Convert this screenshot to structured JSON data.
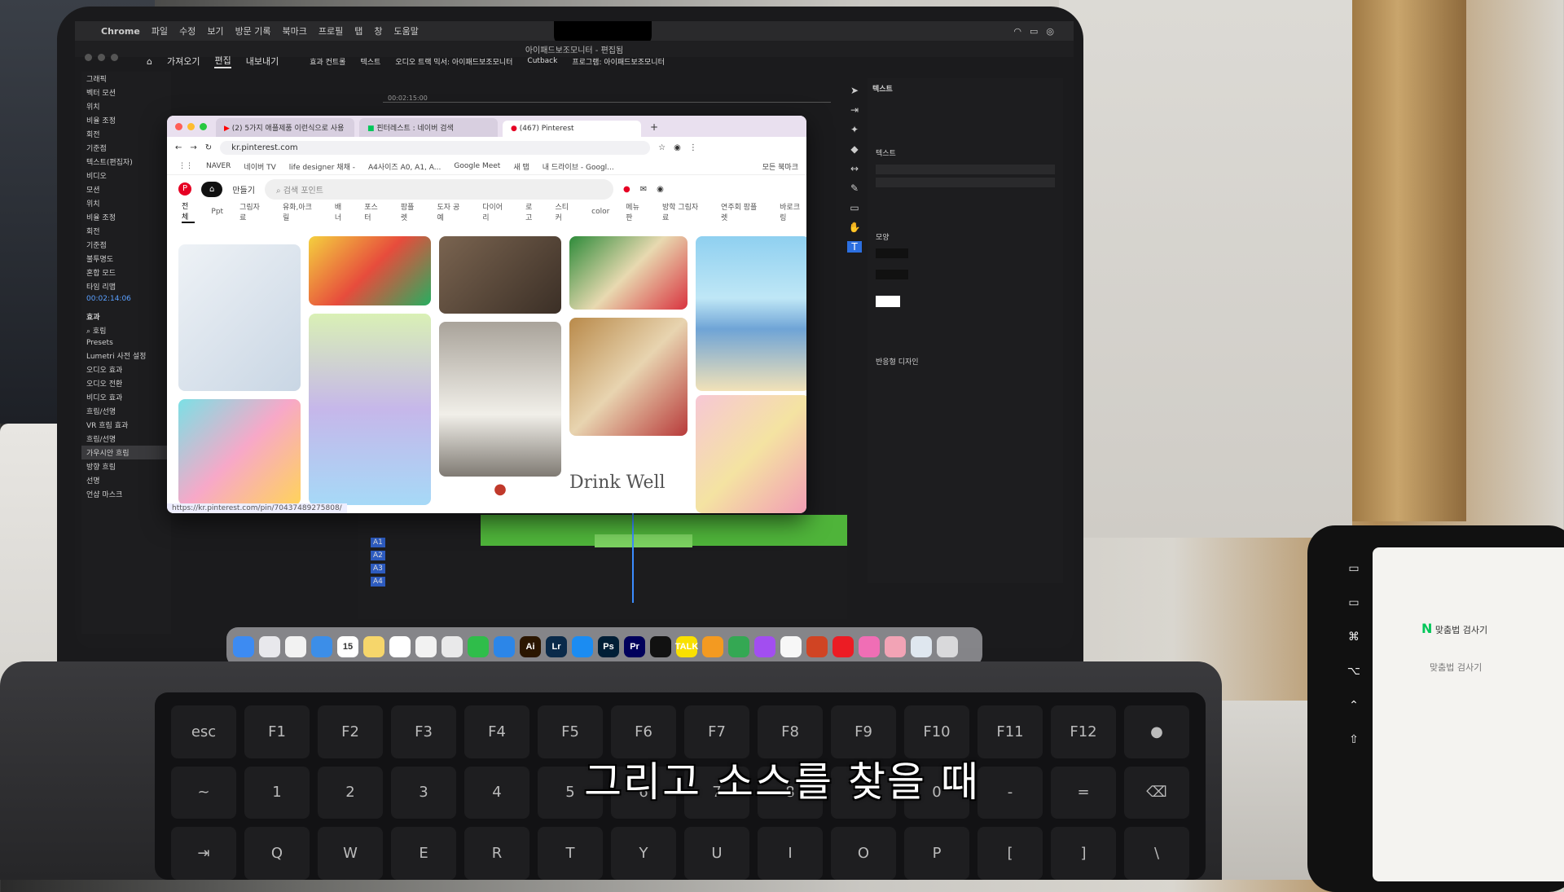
{
  "menubar": {
    "app": "Chrome",
    "items": [
      "파일",
      "수정",
      "보기",
      "방문 기록",
      "북마크",
      "프로필",
      "탭",
      "창",
      "도움말"
    ]
  },
  "premiere": {
    "title": "아이패드보조모니터 - 편집됨",
    "nav": [
      "가져오기",
      "편집",
      "내보내기"
    ],
    "panel_tabs": [
      "효과 컨트롤",
      "텍스트",
      "오디오 트랙 믹서: 아이패드보조모니터",
      "Cutback",
      "프로그램: 아이패드보조모니터"
    ],
    "left_items": [
      "그래픽",
      "벡터 모션",
      "위치",
      "비율 조정",
      "회전",
      "기준점",
      "텍스트(편집자)",
      "비디오",
      "모션",
      "위치",
      "비율 조정",
      "회전",
      "기준점",
      "불투명도",
      "혼합 모드",
      "타임 리맵"
    ],
    "timecode": "00:02:14:06",
    "ruler_time": "00:02:15:00",
    "effects_label": "효과",
    "effects_search": "호림",
    "effects_tree": [
      "Presets",
      "Lumetri 사전 설정",
      "오디오 효과",
      "오디오 전환",
      "비디오 효과",
      "흐림/선명",
      "VR 흐림 효과",
      "흐림/선명",
      "가우시안 흐림",
      "방향 흐림",
      "선명",
      "언샵 마스크"
    ],
    "tracks": [
      "A1",
      "A2",
      "A3",
      "A4"
    ],
    "right_title": "텍스트",
    "right_sections": [
      "텍스트",
      "모양",
      "반응형 디자인"
    ]
  },
  "chrome": {
    "tabs": [
      {
        "label": "(2) 5가지 애플제품 이런식으로 사용"
      },
      {
        "label": "핀터레스트 : 네이버 검색"
      },
      {
        "label": "(467) Pinterest"
      }
    ],
    "url": "kr.pinterest.com",
    "bookmarks": [
      "NAVER",
      "네이버 TV",
      "life designer 채채 -",
      "A4사이즈 A0, A1, A...",
      "Google Meet",
      "새 탭",
      "내 드라이브 - Googl...",
      "모든 북마크"
    ],
    "pinterest": {
      "create": "만들기",
      "search_placeholder": "검색 포인트",
      "categories": [
        "전체",
        "Ppt",
        "그림자료",
        "유화,아크릴",
        "배너",
        "포스터",
        "팜플렛",
        "도자 공예",
        "다이어리",
        "로고",
        "스티커",
        "color",
        "메뉴판",
        "방학 그림자료",
        "연주회 팜플렛",
        "바로크링"
      ],
      "pin_text": "Drink Well",
      "status_url": "https://kr.pinterest.com/pin/70437489275808/"
    }
  },
  "dock": {
    "icons": [
      {
        "name": "finder",
        "label": ""
      },
      {
        "name": "launchpad",
        "label": ""
      },
      {
        "name": "chrome",
        "label": ""
      },
      {
        "name": "safari",
        "label": ""
      },
      {
        "name": "calendar",
        "label": "15"
      },
      {
        "name": "notes",
        "label": ""
      },
      {
        "name": "reminders",
        "label": ""
      },
      {
        "name": "textedit",
        "label": ""
      },
      {
        "name": "mail",
        "label": ""
      },
      {
        "name": "numbers",
        "label": ""
      },
      {
        "name": "keynote",
        "label": ""
      },
      {
        "name": "illustrator",
        "label": "Ai"
      },
      {
        "name": "lightroom",
        "label": "Lr"
      },
      {
        "name": "appstore",
        "label": ""
      },
      {
        "name": "photoshop",
        "label": "Ps"
      },
      {
        "name": "premiere",
        "label": "Pr"
      },
      {
        "name": "capcut",
        "label": ""
      },
      {
        "name": "kakaotalk",
        "label": "TALK"
      },
      {
        "name": "pencil",
        "label": ""
      },
      {
        "name": "drive",
        "label": ""
      },
      {
        "name": "app",
        "label": ""
      },
      {
        "name": "photos",
        "label": ""
      },
      {
        "name": "powerpoint",
        "label": ""
      },
      {
        "name": "acrobat",
        "label": ""
      },
      {
        "name": "app2",
        "label": ""
      },
      {
        "name": "app3",
        "label": ""
      },
      {
        "name": "folder",
        "label": ""
      },
      {
        "name": "trash",
        "label": ""
      }
    ],
    "colors": [
      "#3d8bf2",
      "#e8e8ec",
      "#f2f2f2",
      "#3c8ee8",
      "#ffffff",
      "#f6d66b",
      "#ffffff",
      "#f2f2f2",
      "#e9e9ea",
      "#2fbd4a",
      "#2c86e8",
      "#2b1600",
      "#0a2a4a",
      "#1b8cf2",
      "#001e36",
      "#00005b",
      "#111111",
      "#f9e000",
      "#f39a21",
      "#34a853",
      "#a24ef0",
      "#f7f7f7",
      "#d04423",
      "#ec1c24",
      "#f06eb5",
      "#f2a3b5",
      "#dfe7ef",
      "#d9d9db"
    ]
  },
  "tablet": {
    "app": "N",
    "title": "맞춤법 검사기",
    "items": [
      "맞춤법 검사기"
    ]
  },
  "subtitle": "그리고 소스를 찾을 때"
}
